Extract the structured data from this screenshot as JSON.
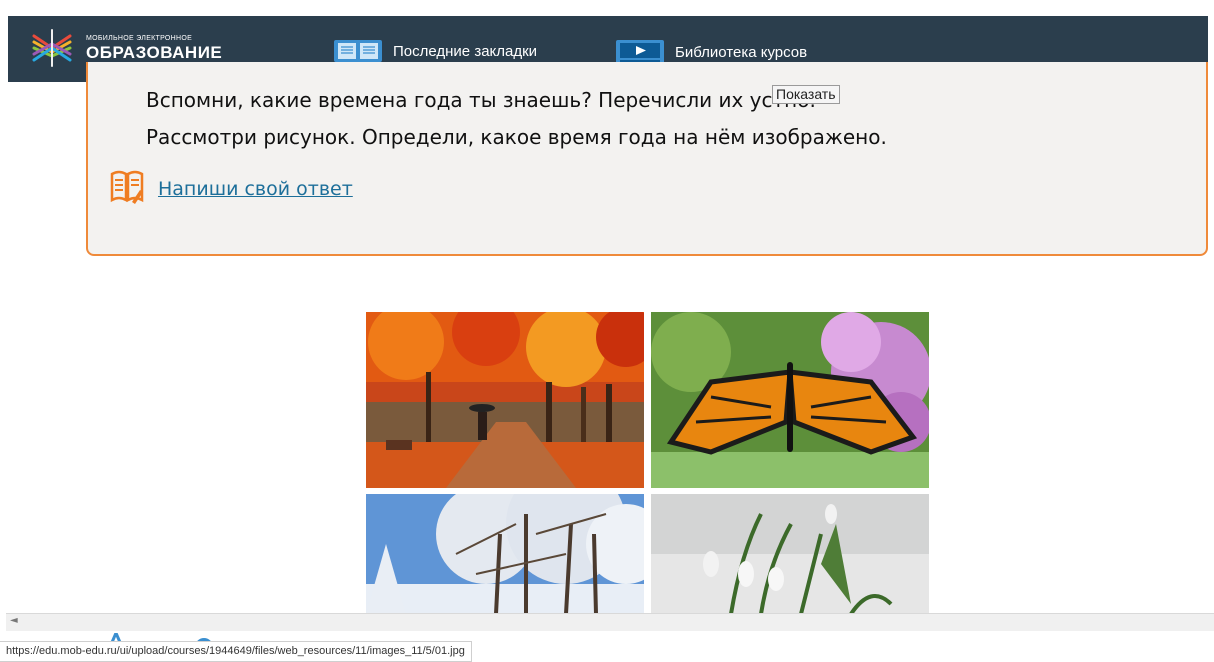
{
  "header": {
    "brand_small": "МОБИЛЬНОЕ ЭЛЕКТРОННОЕ",
    "brand_big": "ОБРАЗОВАНИЕ",
    "nav": [
      {
        "label": "Последние закладки",
        "icon": "book-icon"
      },
      {
        "label": "Библиотека курсов",
        "icon": "video-library-icon"
      }
    ]
  },
  "task": {
    "line1": "Вспомни, какие времена года ты знаешь? Перечисли их устно.",
    "line2": "Рассмотри рисунок. Определи, какое время года на нём изображено.",
    "answer_link": "Напиши свой ответ",
    "answer_icon": "write-answer-icon",
    "border_color": "#ef8a3a"
  },
  "tooltip": "Показать",
  "images": [
    {
      "name": "autumn-park-image"
    },
    {
      "name": "butterfly-flowers-image"
    },
    {
      "name": "snowy-trees-image"
    },
    {
      "name": "snowdrops-image"
    }
  ],
  "status_url": "https://edu.mob-edu.ru/ui/upload/courses/1944649/files/web_resources/11/images_11/5/01.jpg",
  "colors": {
    "navbar": "#2b3e4d",
    "accent": "#ef8a3a",
    "link": "#1d6f9a"
  }
}
